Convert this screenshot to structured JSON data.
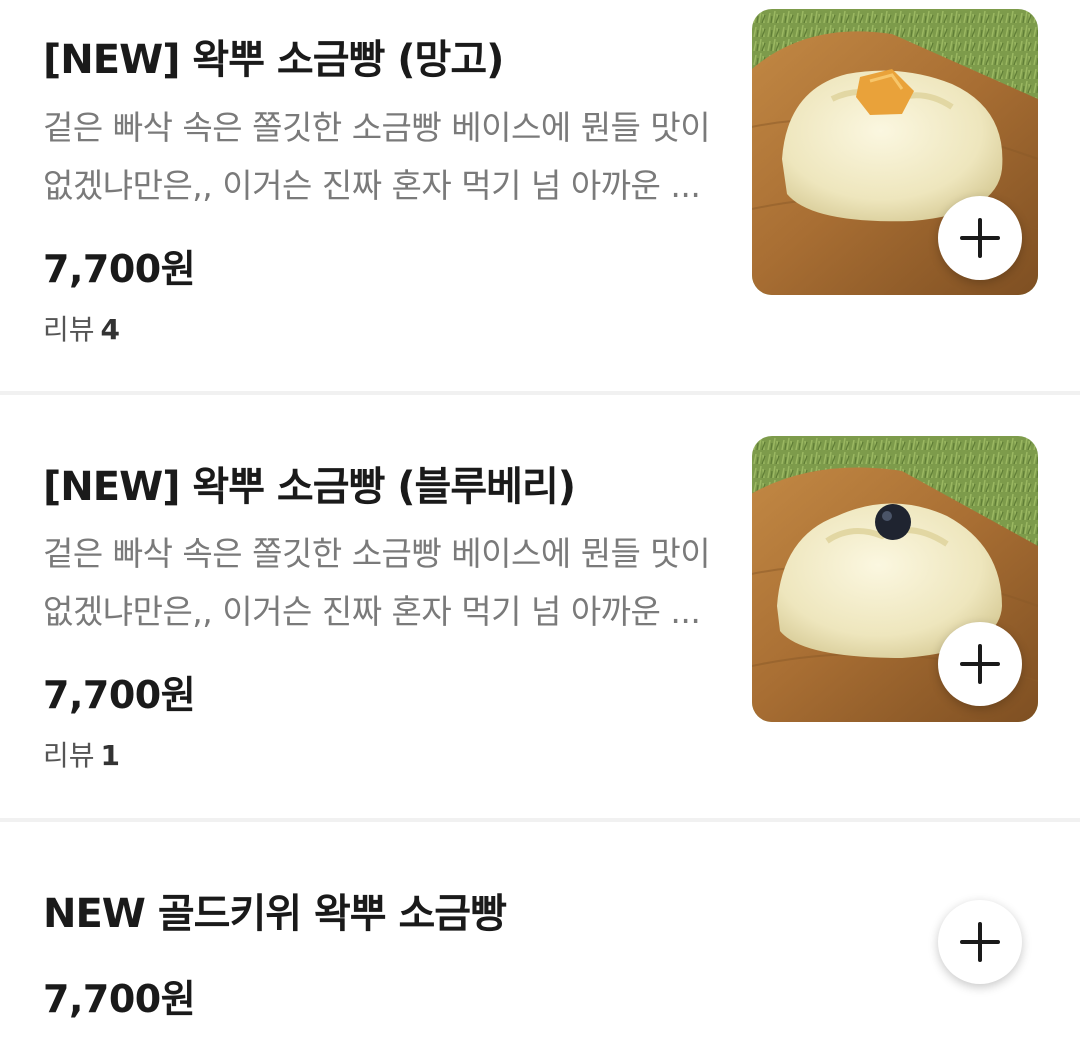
{
  "menu": {
    "items": [
      {
        "title": "[NEW] 왁뿌 소금빵 (망고)",
        "description_line1": "겉은 빠삭 속은 쫄깃한 소금빵 베이스에 뭔들 맛이",
        "description_line2": "없겠냐만은,, 이거슨 진짜 혼자 먹기 넘 아까운 ...",
        "price": "7,700원",
        "review_label": "리뷰",
        "review_count": "4",
        "photo_icon": "bread-mango-photo",
        "topping_color": "#e9a23a"
      },
      {
        "title": "[NEW] 왁뿌 소금빵 (블루베리)",
        "description_line1": "겉은 빠삭 속은 쫄깃한 소금빵 베이스에 뭔들 맛이",
        "description_line2": "없겠냐만은,, 이거슨 진짜 혼자 먹기 넘 아까운 ...",
        "price": "7,700원",
        "review_label": "리뷰",
        "review_count": "1",
        "photo_icon": "bread-blueberry-photo",
        "topping_color": "#1f2430"
      },
      {
        "title": "NEW 골드키위 왁뿌 소금빵",
        "price": "7,700원"
      }
    ],
    "add_icon": "plus-icon"
  },
  "colors": {
    "grass": "#7a9a4a",
    "board": "#b07a3c",
    "bread": "#f2ecc8",
    "text_secondary": "#7a7a7a"
  }
}
